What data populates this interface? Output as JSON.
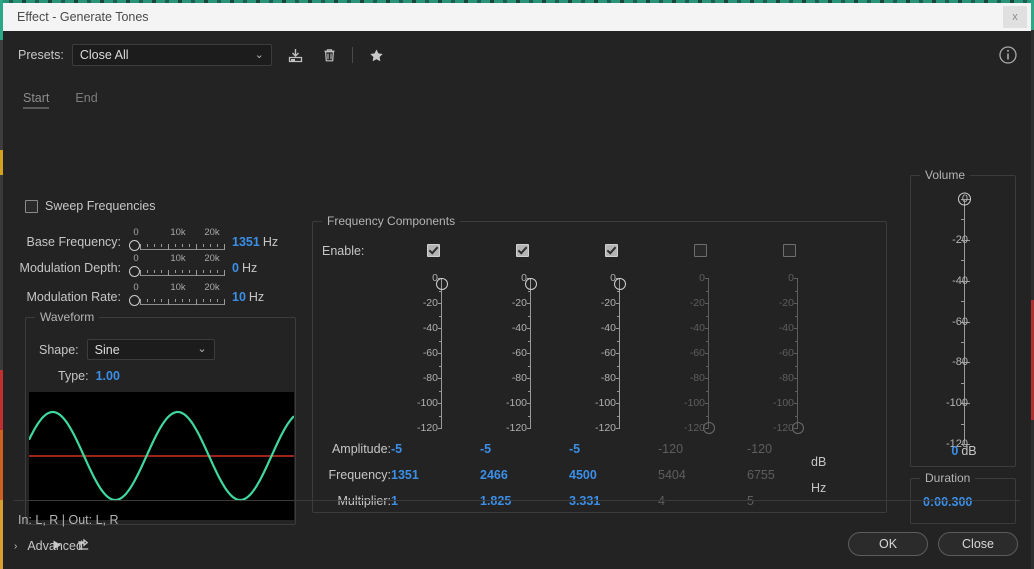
{
  "window": {
    "title": "Effect - Generate Tones",
    "close_label": "x"
  },
  "toolbar": {
    "presets_label": "Presets:",
    "preset_value": "Close All",
    "chevron": "⌄",
    "save_icon": "save-preset-icon",
    "delete_icon": "delete-preset-icon",
    "favorite_icon": "favorite-star-icon",
    "info_icon": "info-icon"
  },
  "tabs": [
    {
      "label": "Start",
      "active": true
    },
    {
      "label": "End",
      "active": false
    }
  ],
  "sweep": {
    "label": "Sweep Frequencies",
    "checked": false
  },
  "sliders": [
    {
      "label": "Base Frequency:",
      "value": "1351",
      "unit": "Hz",
      "ticks": [
        "0",
        "10k",
        "20k"
      ]
    },
    {
      "label": "Modulation Depth:",
      "value": "0",
      "unit": "Hz",
      "ticks": [
        "0",
        "10k",
        "20k"
      ]
    },
    {
      "label": "Modulation Rate:",
      "value": "10",
      "unit": "Hz",
      "ticks": [
        "0",
        "10k",
        "20k"
      ]
    }
  ],
  "waveform": {
    "group_title": "Waveform",
    "shape_label": "Shape:",
    "shape_value": "Sine",
    "chevron": "⌄",
    "type_label": "Type:",
    "type_value": "1.00",
    "curve_color": "#3fd9a0",
    "axis_color": "#d03020",
    "background": "#000000"
  },
  "frequency_components": {
    "group_title": "Frequency Components",
    "enable_label": "Enable:",
    "scale_labels": [
      "0",
      "-20",
      "-40",
      "-60",
      "-80",
      "-100",
      "-120"
    ],
    "scale_min": -120,
    "scale_max": 0,
    "row_labels": [
      "Amplitude:",
      "Frequency:",
      "Multiplier:"
    ],
    "units": [
      "dB",
      "Hz"
    ],
    "columns": [
      {
        "enabled": true,
        "amplitude": "-5",
        "frequency": "1351",
        "multiplier": "1"
      },
      {
        "enabled": true,
        "amplitude": "-5",
        "frequency": "2466",
        "multiplier": "1.825"
      },
      {
        "enabled": true,
        "amplitude": "-5",
        "frequency": "4500",
        "multiplier": "3.331"
      },
      {
        "enabled": false,
        "amplitude": "-120",
        "frequency": "5404",
        "multiplier": "4"
      },
      {
        "enabled": false,
        "amplitude": "-120",
        "frequency": "6755",
        "multiplier": "5"
      }
    ]
  },
  "volume": {
    "group_title": "Volume",
    "scale_labels": [
      "0",
      "-20",
      "-40",
      "-60",
      "-80",
      "-100",
      "-120"
    ],
    "value": "0",
    "unit": "dB",
    "handle_db": 0
  },
  "duration": {
    "group_title": "Duration",
    "value": "0:00.300"
  },
  "advanced": {
    "label": "Advanced",
    "chevron": "›",
    "expanded": false
  },
  "footer": {
    "io_text": "In: L, R | Out: L, R",
    "play_icon": "play-icon",
    "loop_icon": "loop-export-icon",
    "ok_label": "OK",
    "close_label": "Close"
  },
  "colors": {
    "accent_blue": "#3b8fe8",
    "panel_bg": "#232323",
    "disabled_text": "#5e5e5e"
  }
}
